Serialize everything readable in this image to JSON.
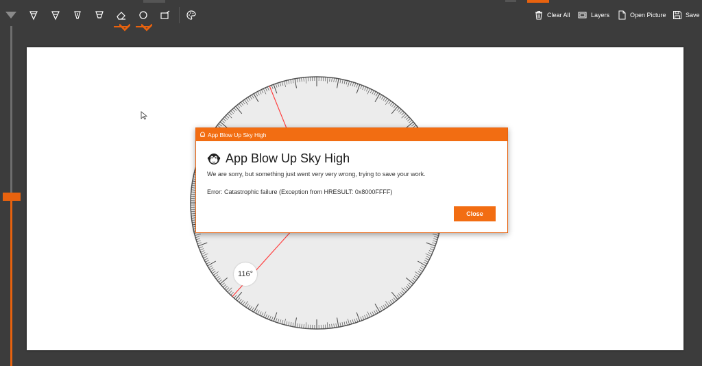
{
  "colors": {
    "accent": "#e8620e",
    "chrome": "#3c3c3c",
    "canvas": "#ffffff"
  },
  "toolbar": {
    "tools": [
      {
        "name": "ballpoint-pen-icon"
      },
      {
        "name": "pencil-icon"
      },
      {
        "name": "calligraphy-pen-icon"
      },
      {
        "name": "highlighter-icon"
      },
      {
        "name": "eraser-icon"
      },
      {
        "name": "shape-circle-icon"
      },
      {
        "name": "ruler-icon"
      },
      {
        "name": "palette-icon"
      }
    ],
    "clear_all": "Clear All",
    "layers": "Layers",
    "open_picture": "Open Picture",
    "save": "Save"
  },
  "protractor": {
    "angle_label": "116°",
    "angle": 116
  },
  "dialog": {
    "titlebar": "App Blow Up Sky High",
    "title": "App Blow Up Sky High",
    "message": "We are sorry, but something just went very very wrong, trying to save your work.",
    "error": "Error: Catastrophic failure (Exception from HRESULT: 0x8000FFFF)",
    "close_label": "Close"
  },
  "slider": {
    "level_percent": 50
  }
}
